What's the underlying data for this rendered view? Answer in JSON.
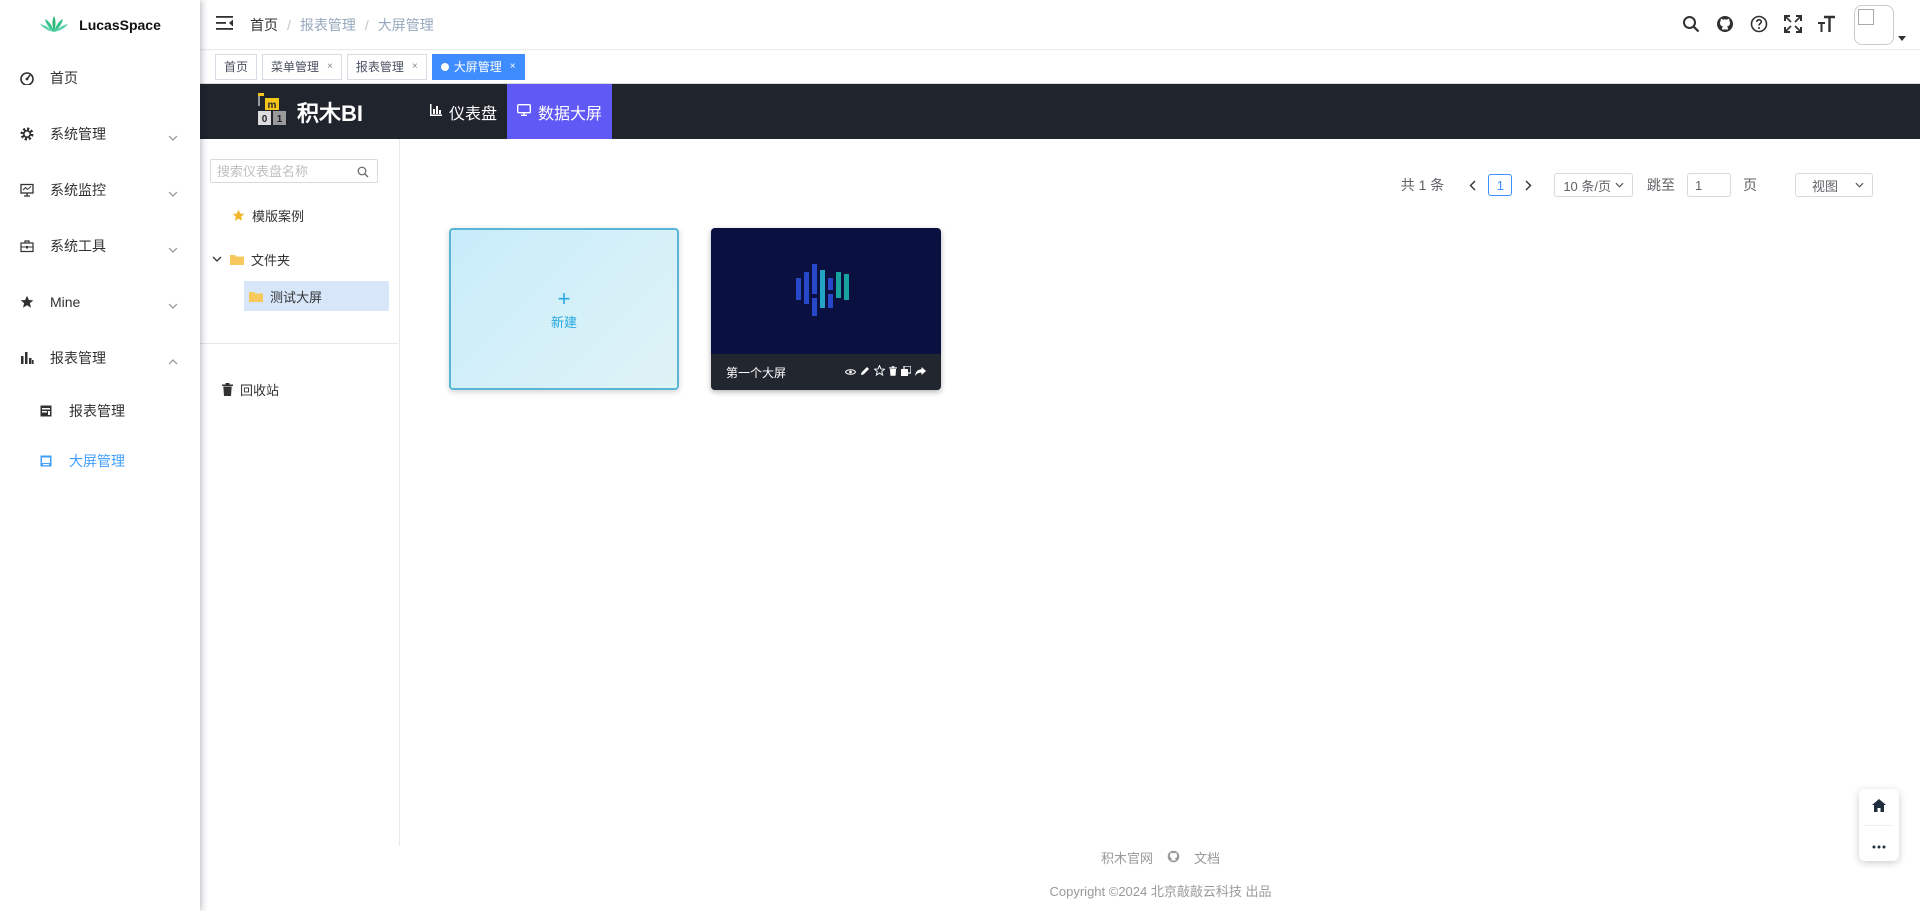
{
  "sidebar": {
    "brand": "LucasSpace",
    "menu": [
      {
        "label": "首页"
      },
      {
        "label": "系统管理"
      },
      {
        "label": "系统监控"
      },
      {
        "label": "系统工具"
      },
      {
        "label": "Mine"
      },
      {
        "label": "报表管理"
      }
    ],
    "submenu": [
      {
        "label": "报表管理"
      },
      {
        "label": "大屏管理"
      }
    ]
  },
  "breadcrumb": [
    "首页",
    "报表管理",
    "大屏管理"
  ],
  "tags": [
    {
      "label": "首页"
    },
    {
      "label": "菜单管理"
    },
    {
      "label": "报表管理"
    },
    {
      "label": "大屏管理"
    }
  ],
  "jimu": {
    "logo": "积木BI",
    "tabs": [
      {
        "label": "仪表盘"
      },
      {
        "label": "数据大屏"
      }
    ]
  },
  "tree": {
    "search_placeholder": "搜索仪表盘名称",
    "template": "模版案例",
    "folder": "文件夹",
    "child": "测试大屏",
    "recycle": "回收站"
  },
  "pager": {
    "total": "共 1 条",
    "current": "1",
    "size": "10 条/页",
    "jump_label": "跳至",
    "jump_value": "1",
    "page_unit": "页",
    "view": "视图"
  },
  "cards": {
    "new_label": "新建",
    "screen_name": "第一个大屏"
  },
  "footer": {
    "link1": "积木官网",
    "link2": "文档",
    "copyright": "Copyright ©2024 北京敲敲云科技 出品"
  },
  "colors": {
    "accent": "#409eff",
    "jm_active": "#6159f5",
    "jm_header": "#20242c"
  }
}
